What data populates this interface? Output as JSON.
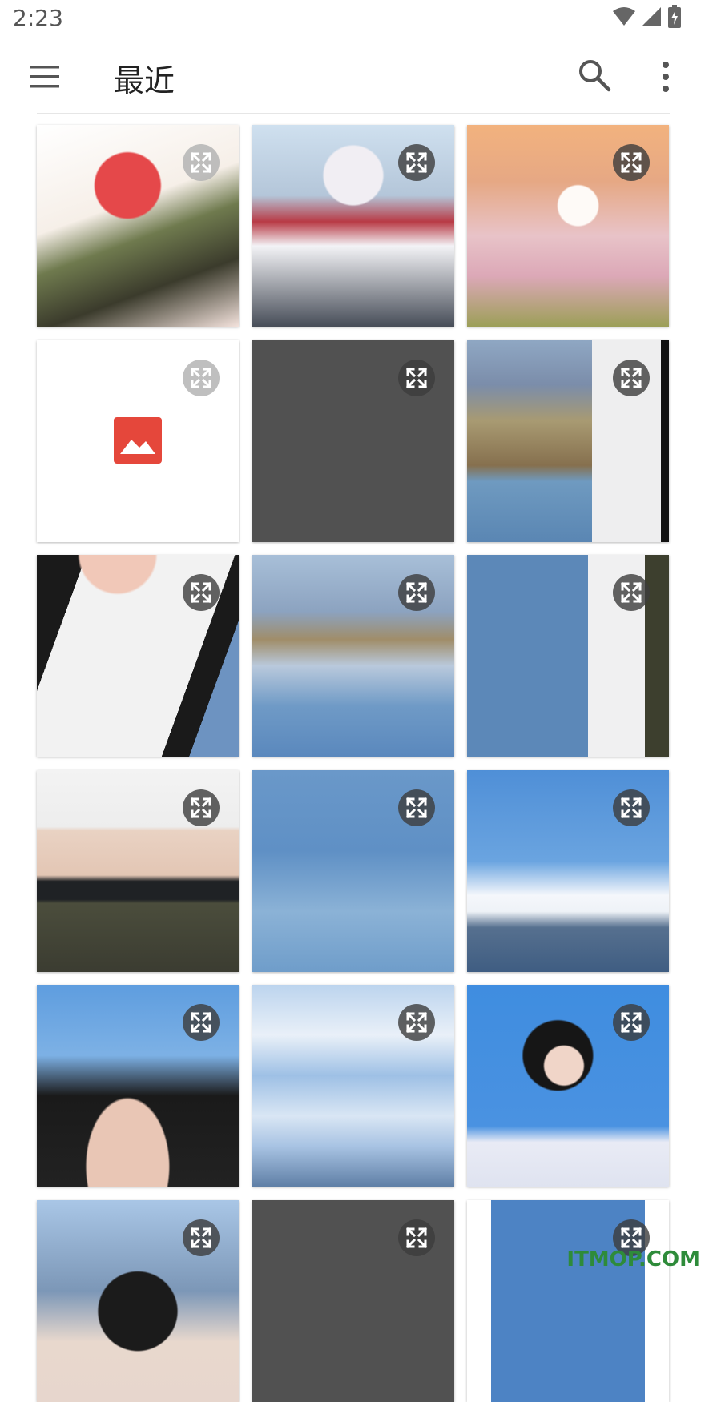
{
  "status_bar": {
    "time": "2:23"
  },
  "app_bar": {
    "title": "最近",
    "menu_icon": "hamburger-menu-icon",
    "search_icon": "search-icon",
    "more_icon": "more-vert-icon"
  },
  "grid": {
    "tiles": [
      {
        "kind": "anime-red-hair-sword",
        "expand_style": "light"
      },
      {
        "kind": "anime-white-hair-bunny",
        "expand_style": "dark"
      },
      {
        "kind": "girl-flower-field",
        "expand_style": "dark"
      },
      {
        "kind": "placeholder",
        "expand_style": "light"
      },
      {
        "kind": "blank-gray",
        "expand_style": "dark"
      },
      {
        "kind": "lake-mountains-shirt",
        "expand_style": "dark"
      },
      {
        "kind": "girl-white-tshirt",
        "expand_style": "dark"
      },
      {
        "kind": "lake-hair-strands",
        "expand_style": "dark"
      },
      {
        "kind": "lake-sleeve-skirt",
        "expand_style": "dark"
      },
      {
        "kind": "girl-belt-skirt",
        "expand_style": "dark"
      },
      {
        "kind": "water-hand",
        "expand_style": "dark"
      },
      {
        "kind": "sky-clouds-mountains",
        "expand_style": "dark"
      },
      {
        "kind": "girl-face-sky",
        "expand_style": "dark"
      },
      {
        "kind": "clouds-sky",
        "expand_style": "dark"
      },
      {
        "kind": "girl-blue-background",
        "expand_style": "dark"
      },
      {
        "kind": "girl-mountains-small",
        "expand_style": "dark"
      },
      {
        "kind": "blank-gray",
        "expand_style": "dark"
      },
      {
        "kind": "girl-helmet-blue",
        "expand_style": "dark"
      }
    ]
  },
  "watermark": "ITMOP.COM",
  "colors": {
    "accent_red": "#e5473b",
    "gray_tile": "#515151",
    "watermark_green": "#2e8b3a"
  }
}
